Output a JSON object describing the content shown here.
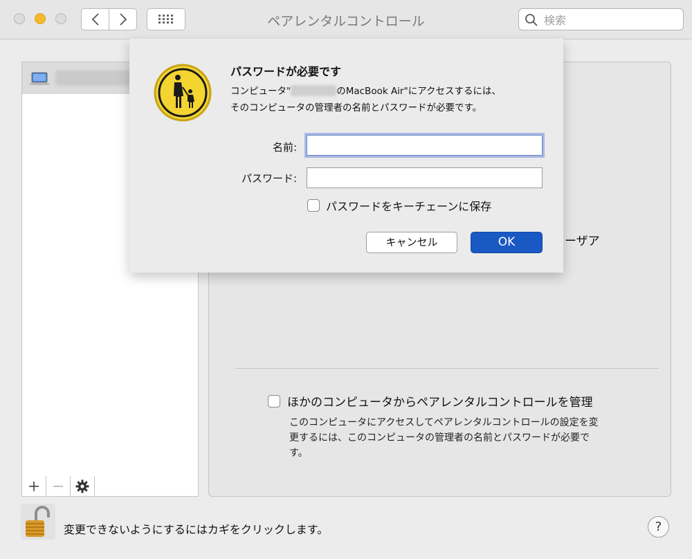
{
  "window": {
    "title": "ペアレンタルコントロール",
    "search_placeholder": "検索"
  },
  "sidebar": {
    "items": [
      {
        "label": "",
        "icon": "laptop-icon",
        "selected": true
      }
    ],
    "add_label": "+",
    "remove_label": "−"
  },
  "dialog": {
    "title": "パスワードが必要です",
    "message_part1": "コンピュータ\"",
    "message_part2": "のMacBook Air\"にアクセスするには、",
    "message_line2": "そのコンピュータの管理者の名前とパスワードが必要です。",
    "name_label": "名前:",
    "name_value": "",
    "password_label": "パスワード:",
    "password_value": "",
    "keychain_label": "パスワードをキーチェーンに保存",
    "keychain_checked": false,
    "cancel_label": "キャンセル",
    "ok_label": "OK"
  },
  "main": {
    "user_label_fragment": "ーザア",
    "remote_manage_label": "ほかのコンピュータからペアレンタルコントロールを管理",
    "remote_manage_checked": false,
    "remote_manage_desc": "このコンピュータにアクセスしてペアレンタルコントロールの設定を変更するには、このコンピュータの管理者の名前とパスワードが必要です。"
  },
  "footer": {
    "lock_text": "変更できないようにするにはカギをクリックします。",
    "help_label": "?"
  },
  "colors": {
    "accent": "#1a58c4",
    "focus_ring": "#a6b9e4",
    "minimize": "#f5b82e"
  }
}
